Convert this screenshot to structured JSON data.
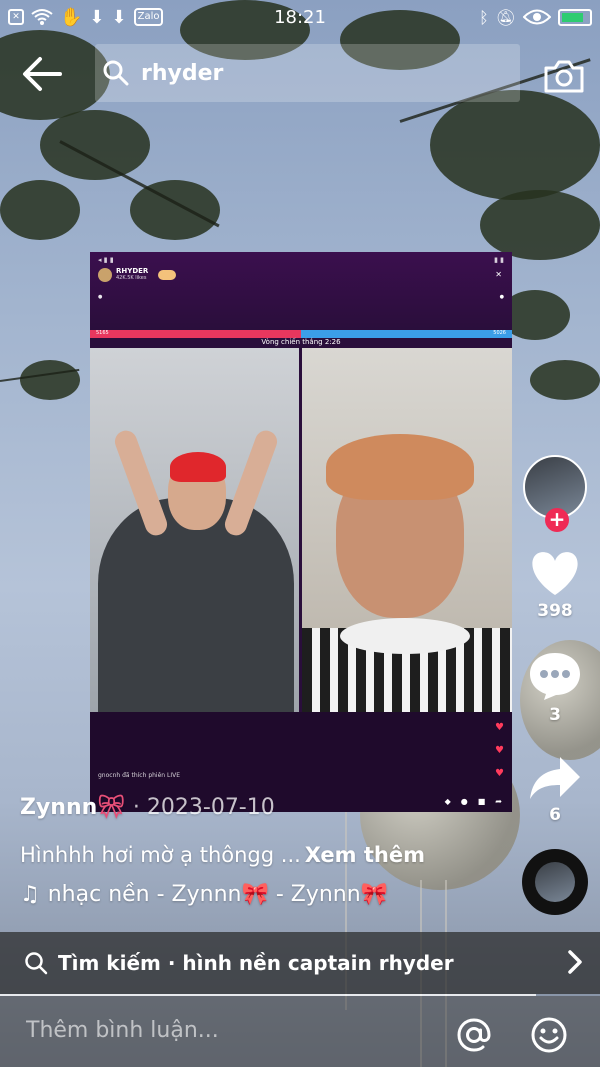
{
  "status_bar": {
    "time": "18:21",
    "zalo_label": "Zalo"
  },
  "search": {
    "query": "rhyder"
  },
  "video_frame": {
    "host_name": "RHYDER",
    "host_followers": "42K.5K likes",
    "battle_timer_label": "Vòng chiến thắng 2:26",
    "score_left": "5165",
    "score_right": "5026",
    "gift_notice": "gnocnh đã thích phiên LIVE"
  },
  "post": {
    "author": "Zynnn",
    "date": "2023-07-10",
    "caption": "Hìnhhh hơi mờ ạ thôngg ...",
    "see_more": "Xem thêm",
    "music": "nhạc nền - Zynnn🎀 - Zynnn🎀"
  },
  "actions": {
    "likes": "398",
    "comments": "3",
    "shares": "6"
  },
  "related_search": {
    "label": "Tìm kiếm · hình nền captain rhyder"
  },
  "comment": {
    "placeholder": "Thêm bình luận..."
  },
  "colors": {
    "follow_red": "#ef2a55",
    "battery_green": "#2ecc71",
    "score_red": "#e8375e",
    "score_blue": "#3b9ee8"
  }
}
